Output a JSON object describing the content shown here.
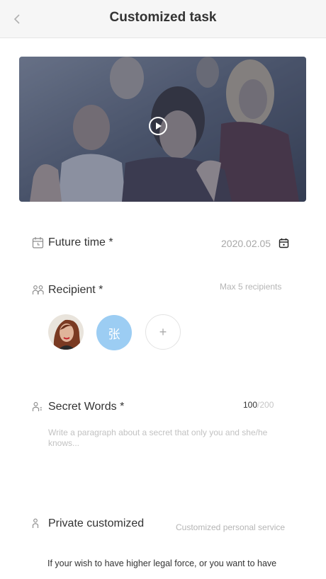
{
  "header": {
    "back_icon": "chevron-left-icon",
    "title": "Customized task"
  },
  "video": {
    "play_icon": "play-circle-icon"
  },
  "future_time": {
    "icon": "calendar-icon",
    "label": "Future time *",
    "value": "2020.02.05",
    "picker_icon": "calendar-picker-icon"
  },
  "recipient": {
    "icon": "people-icon",
    "label": "Recipient *",
    "hint": "Max 5 recipients",
    "avatars": [
      {
        "type": "photo"
      },
      {
        "type": "initial",
        "text": "张",
        "color": "#9ccdf3"
      }
    ],
    "add_label": "+"
  },
  "secret_words": {
    "icon": "person-lines-icon",
    "label": "Secret Words *",
    "count": "100",
    "max": "/200",
    "placeholder": "Write a paragraph about a secret that only you and she/he knows..."
  },
  "private_customized": {
    "icon": "person-icon",
    "label": "Private customized",
    "hint": "Customized personal service",
    "description": "If your wish to have higher legal force, or you want to have"
  }
}
